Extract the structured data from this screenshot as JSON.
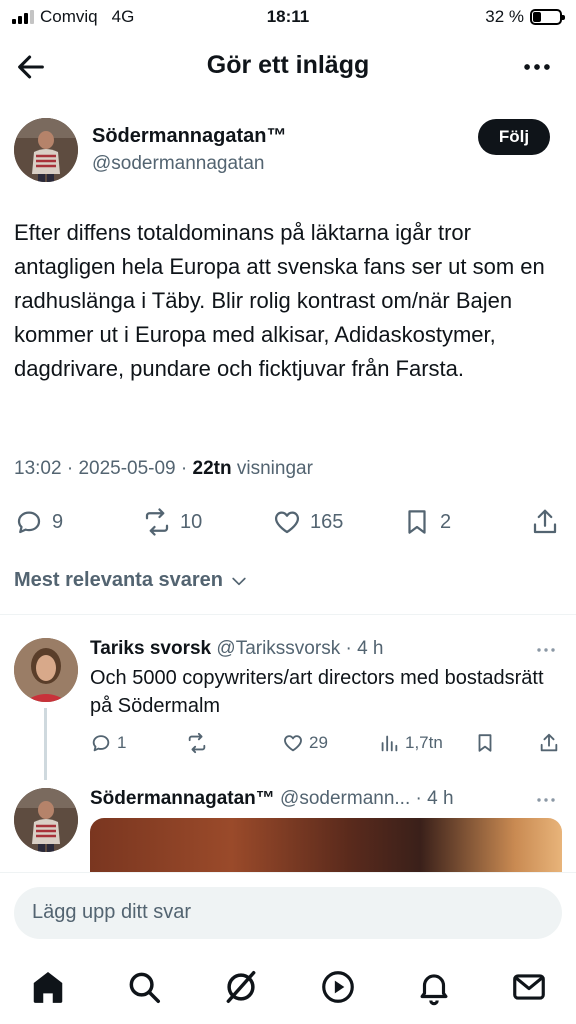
{
  "status_bar": {
    "carrier": "Comviq",
    "network": "4G",
    "time": "18:11",
    "battery": "32 %",
    "battery_level": 0.32
  },
  "header": {
    "title": "Gör ett inlägg"
  },
  "post": {
    "author_name": "Södermannagatan™",
    "author_handle": "@sodermannagatan",
    "follow_label": "Följ",
    "text": "Efter diffens totaldominans på läktarna igår tror antagligen hela Europa att svenska fans ser ut som en radhuslänga i Täby. Blir rolig kontrast om/när Bajen kommer ut i Europa med alkisar, Adidaskostymer, dagdrivare, pundare och ficktjuvar från Farsta.",
    "time": "13:02",
    "date": "2025-05-09",
    "views_count": "22tn",
    "views_label": "visningar",
    "replies": "9",
    "reposts": "10",
    "likes": "165",
    "bookmarks": "2"
  },
  "sort": {
    "label": "Mest relevanta svaren"
  },
  "replies": [
    {
      "name": "Tariks svorsk",
      "handle": "@Tarikssvorsk",
      "age": "· 4 h",
      "text": "Och 5000 copywriters/art directors med bostadsrätt på Södermalm",
      "replies": "1",
      "reposts": "",
      "likes": "29",
      "views": "1,7tn"
    },
    {
      "name": "Södermannagatan™",
      "handle": "@sodermann...",
      "age": "· 4 h"
    }
  ],
  "composer": {
    "placeholder": "Lägg upp ditt svar"
  },
  "tabbar": {
    "items": [
      "home-icon",
      "search-icon",
      "grok-icon",
      "video-icon",
      "notifications-icon",
      "messages-icon"
    ]
  }
}
